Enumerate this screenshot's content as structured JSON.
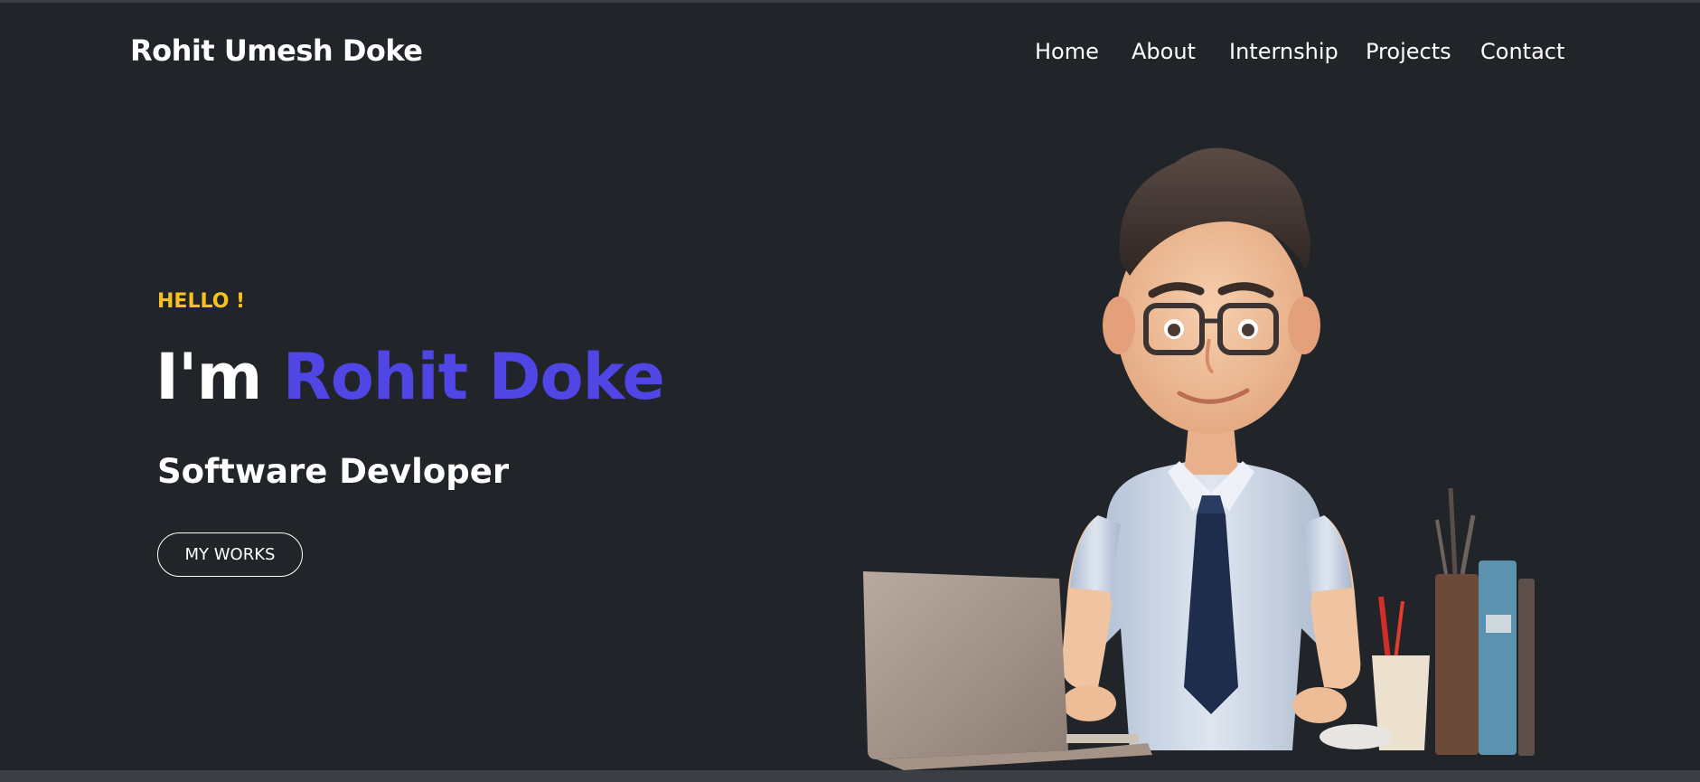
{
  "header": {
    "brand": "Rohit Umesh Doke",
    "nav": [
      {
        "label": "Home"
      },
      {
        "label": "About"
      },
      {
        "label": "Internship"
      },
      {
        "label": "Projects"
      },
      {
        "label": "Contact"
      }
    ]
  },
  "hero": {
    "greeting": "HELLO !",
    "title_prefix": "I'm",
    "title_name": "Rohit Doke",
    "role": "Software Devloper",
    "cta_label": "MY WORKS"
  },
  "colors": {
    "background": "#212429",
    "accent_name": "#5046e5",
    "greeting": "#f7c21d",
    "text": "#ffffff"
  }
}
